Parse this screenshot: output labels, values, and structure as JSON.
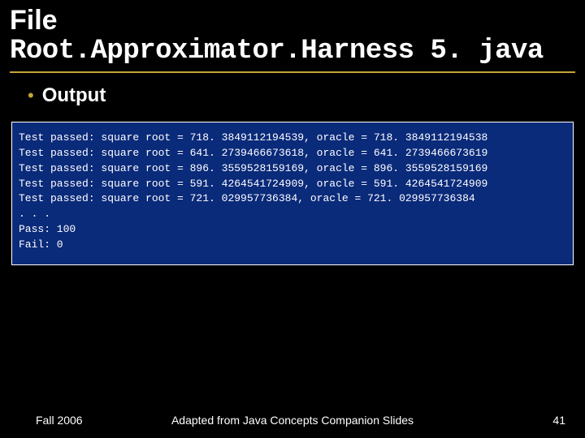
{
  "title": "File",
  "subtitle": "Root.Approximator.Harness 5. java",
  "bullet": "Output",
  "output_lines": [
    "Test passed: square root = 718. 3849112194539, oracle = 718. 3849112194538",
    "Test passed: square root = 641. 2739466673618, oracle = 641. 2739466673619",
    "Test passed: square root = 896. 3559528159169, oracle = 896. 3559528159169",
    "Test passed: square root = 591. 4264541724909, oracle = 591. 4264541724909",
    "Test passed: square root = 721. 029957736384, oracle = 721. 029957736384",
    ". . .",
    "Pass: 100",
    "Fail: 0"
  ],
  "footer": {
    "left": "Fall 2006",
    "center": "Adapted from Java Concepts Companion Slides",
    "right": "41"
  }
}
